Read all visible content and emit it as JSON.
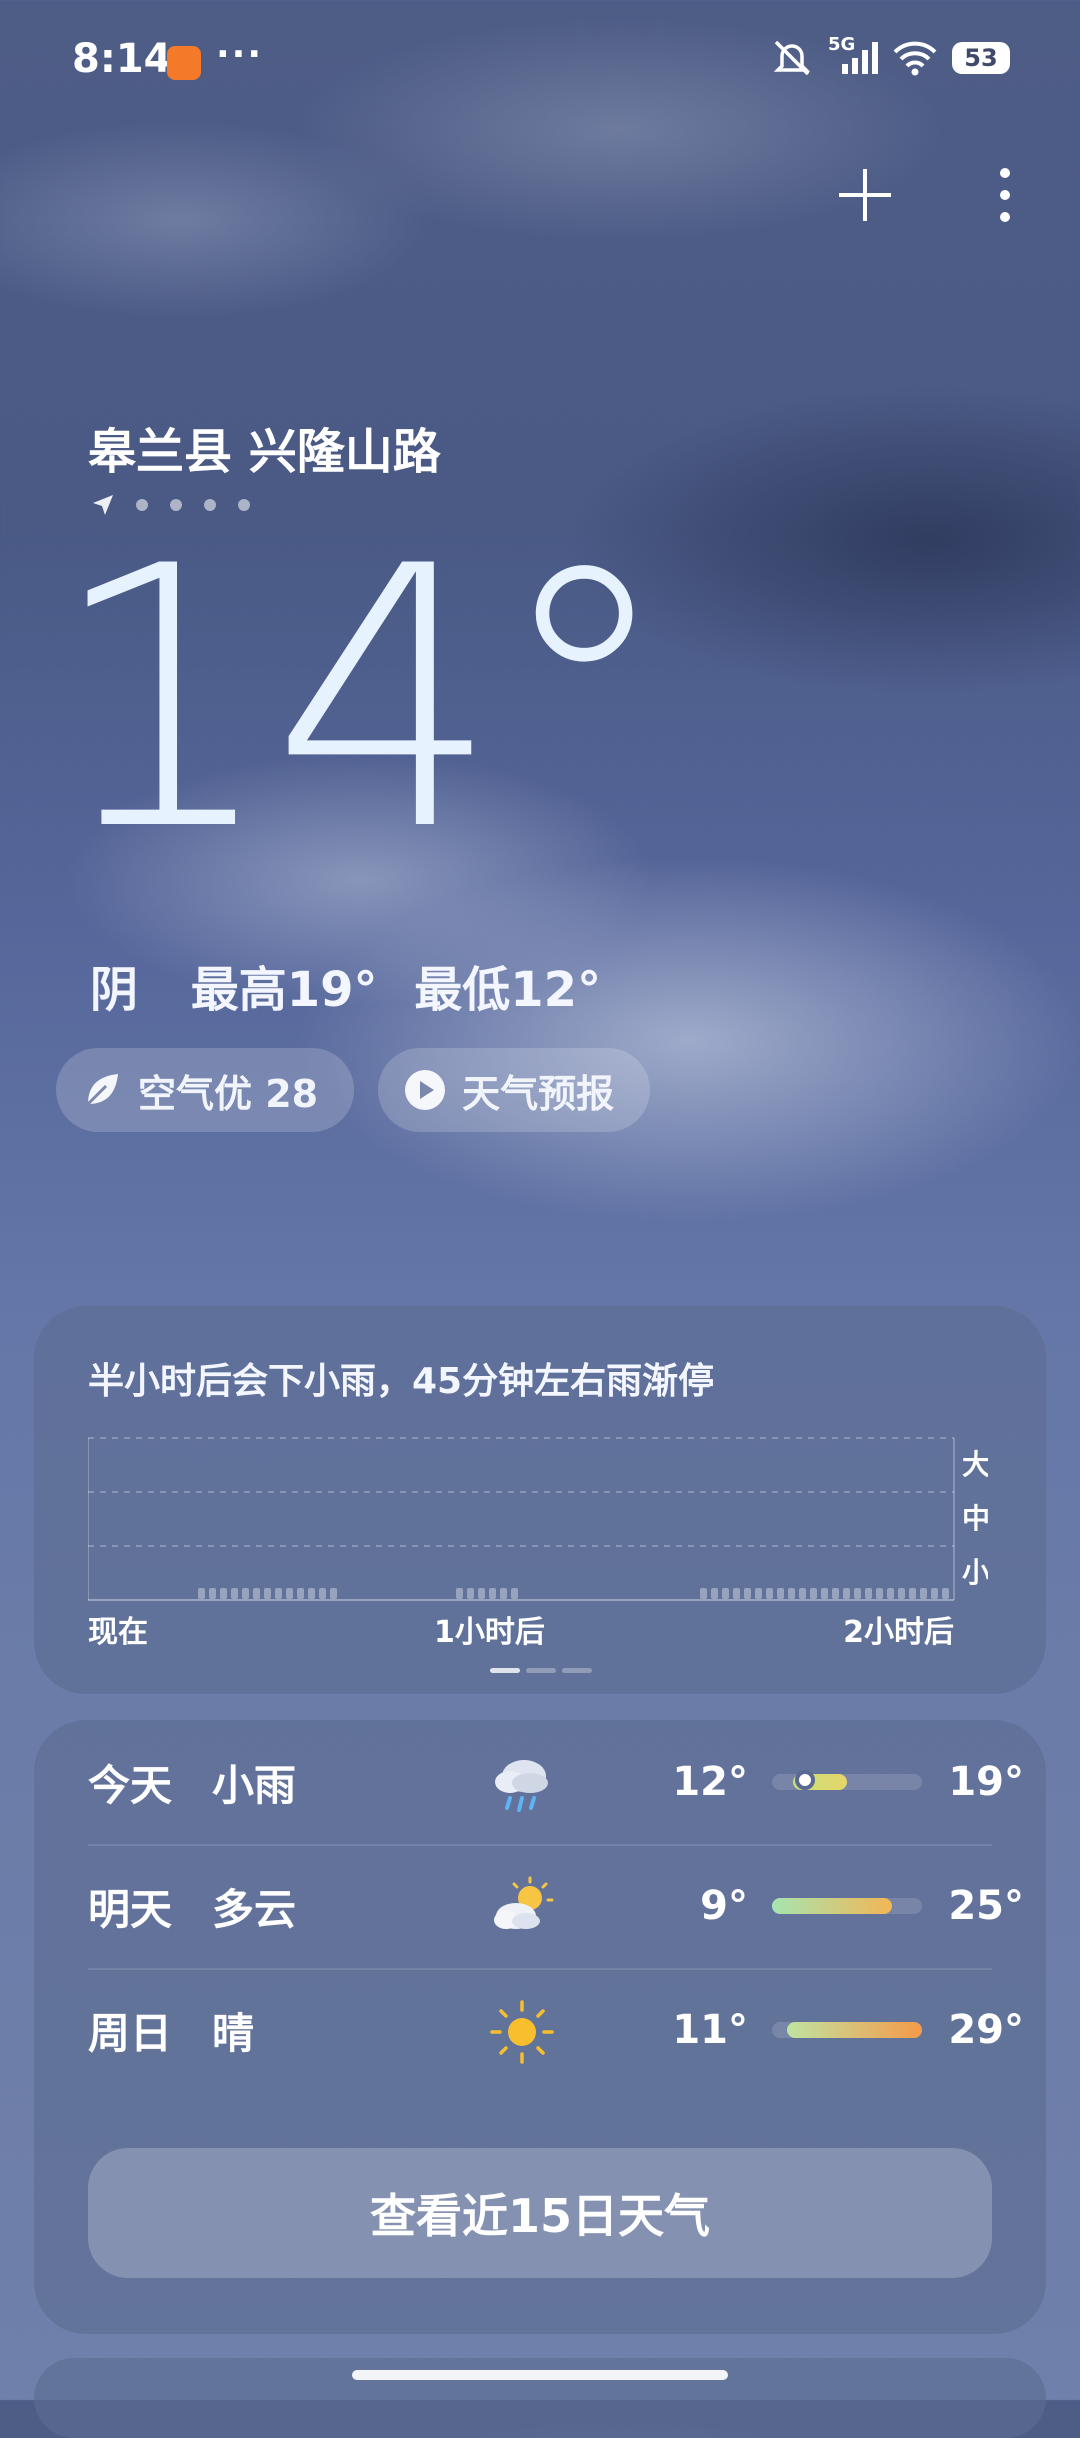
{
  "status_bar": {
    "time": "8:14",
    "more": "···",
    "network": "5G",
    "battery": "53"
  },
  "location": {
    "name": "皋兰县 兴隆山路",
    "page_count": 5,
    "current_page": 1
  },
  "current": {
    "temperature": "14°",
    "condition": "阴",
    "high": "最高19°",
    "low": "最低12°"
  },
  "chips": {
    "air_quality": "空气优 28",
    "forecast_video": "天气预报"
  },
  "precipitation": {
    "message": "半小时后会下小雨，45分钟左右雨渐停",
    "x_labels": [
      "现在",
      "1小时后",
      "2小时后"
    ],
    "levels": [
      "大",
      "中",
      "小"
    ]
  },
  "daily": [
    {
      "day": "今天",
      "condition": "小雨",
      "icon": "rain-cloud-icon",
      "low": "12°",
      "high": "19°",
      "range_start": 0.14,
      "range_end": 0.5,
      "current": 0.22,
      "colors": [
        "#c8e07a",
        "#e6d56a"
      ]
    },
    {
      "day": "明天",
      "condition": "多云",
      "icon": "partly-cloudy-icon",
      "low": "9°",
      "high": "25°",
      "range_start": 0.0,
      "range_end": 0.8,
      "colors": [
        "#a6e4b0",
        "#f2b655"
      ]
    },
    {
      "day": "周日",
      "condition": "晴",
      "icon": "sun-icon",
      "low": "11°",
      "high": "29°",
      "range_start": 0.1,
      "range_end": 1.0,
      "colors": [
        "#bfe4a0",
        "#f59a4a"
      ]
    }
  ],
  "more_button": "查看近15日天气",
  "colors": {
    "bg_top": "#4e5d86",
    "bg_bottom": "#6f80aa",
    "temp": "#e7f2ff"
  }
}
